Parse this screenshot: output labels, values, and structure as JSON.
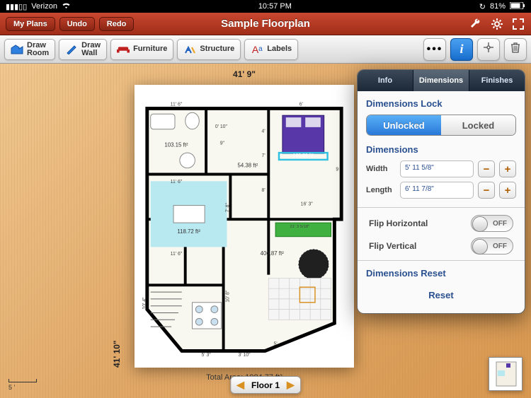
{
  "status": {
    "carrier": "Verizon",
    "time": "10:57 PM",
    "battery": "81%"
  },
  "header": {
    "my_plans": "My Plans",
    "undo": "Undo",
    "redo": "Redo",
    "title": "Sample Floorplan"
  },
  "toolbar": {
    "draw_room": "Draw\nRoom",
    "draw_wall": "Draw\nWall",
    "furniture": "Furniture",
    "structure": "Structure",
    "labels": "Labels"
  },
  "floorplan": {
    "width_label": "41' 9\"",
    "height_label": "41' 10\"",
    "total_area": "Total Area:  1984.77 ft²",
    "rooms": [
      {
        "label": "103.15 ft²"
      },
      {
        "label": "54.38 ft²"
      },
      {
        "label": "180.99 ft²"
      },
      {
        "label": "118.72 ft²"
      },
      {
        "label": "406.87 ft²"
      }
    ],
    "dims": [
      "11' 6\"",
      "6'",
      "4'",
      "7'",
      "9\"",
      "11' 6\"",
      "11' 6\"",
      "10' 4\"",
      "5' 3\"",
      "3' 10\"",
      "5'",
      "7' 8\"",
      "10' 8\"",
      "16' 3\"",
      "21' 3 5/18\"",
      "0' 10\"",
      "8'",
      "9"
    ],
    "floor_nav": "Floor 1",
    "scale": "5 '"
  },
  "popover": {
    "tabs": {
      "info": "Info",
      "dimensions": "Dimensions",
      "finishes": "Finishes"
    },
    "lock": {
      "title": "Dimensions Lock",
      "unlocked": "Unlocked",
      "locked": "Locked"
    },
    "dims": {
      "title": "Dimensions",
      "width_label": "Width",
      "width_value": "5' 11 5/8\"",
      "length_label": "Length",
      "length_value": "6' 11 7/8\""
    },
    "flip": {
      "horizontal": "Flip Horizontal",
      "vertical": "Flip Vertical",
      "off": "OFF"
    },
    "reset": {
      "title": "Dimensions Reset",
      "button": "Reset"
    }
  }
}
